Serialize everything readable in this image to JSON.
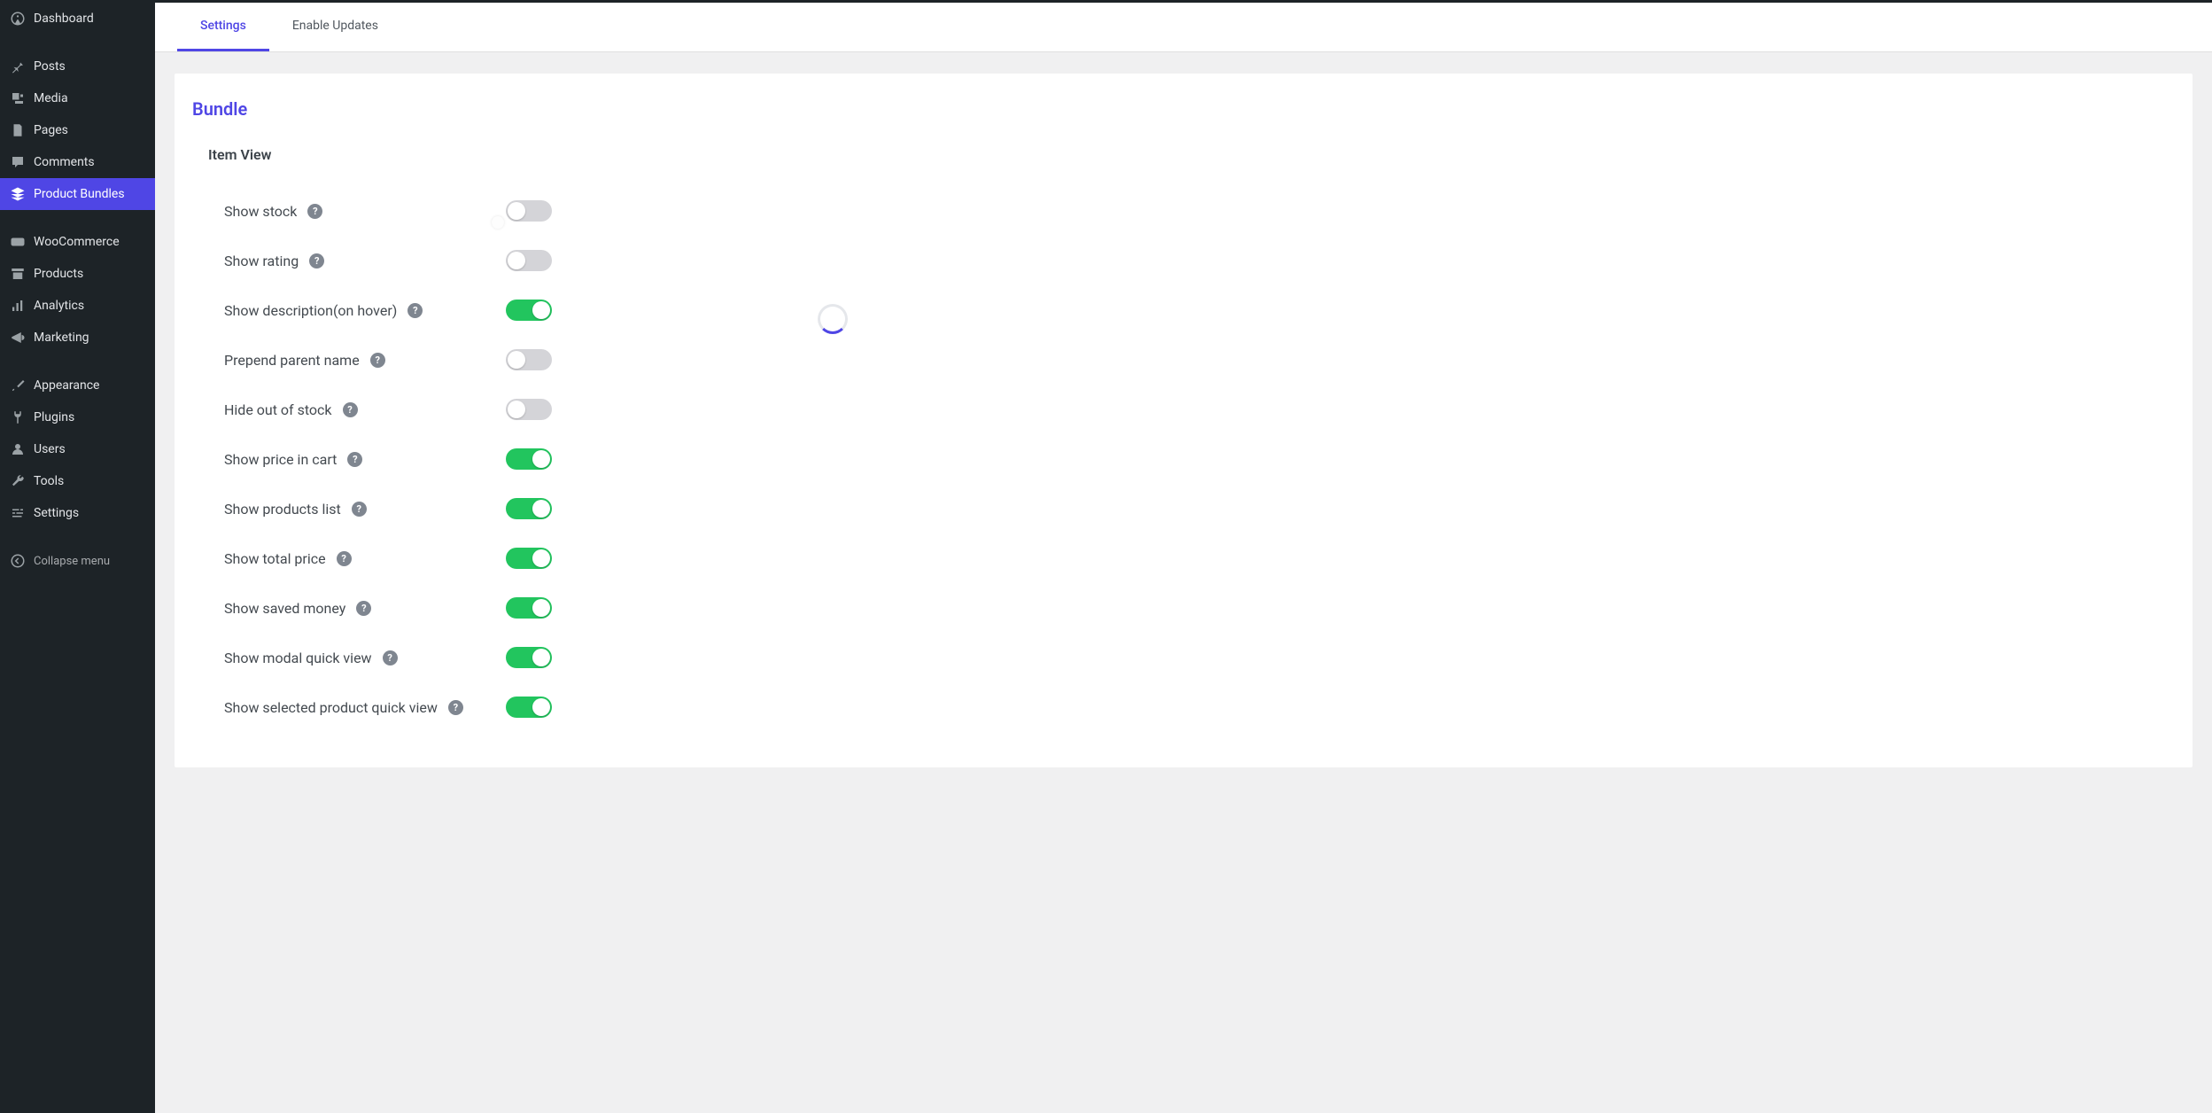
{
  "sidebar": {
    "items": [
      {
        "label": "Dashboard",
        "icon": "dashboard"
      },
      {
        "label": "Posts",
        "icon": "pin"
      },
      {
        "label": "Media",
        "icon": "media"
      },
      {
        "label": "Pages",
        "icon": "page"
      },
      {
        "label": "Comments",
        "icon": "comment"
      },
      {
        "label": "Product Bundles",
        "icon": "layers",
        "active": true
      },
      {
        "label": "WooCommerce",
        "icon": "woo"
      },
      {
        "label": "Products",
        "icon": "archive"
      },
      {
        "label": "Analytics",
        "icon": "analytics"
      },
      {
        "label": "Marketing",
        "icon": "marketing"
      },
      {
        "label": "Appearance",
        "icon": "brush"
      },
      {
        "label": "Plugins",
        "icon": "plug"
      },
      {
        "label": "Users",
        "icon": "user"
      },
      {
        "label": "Tools",
        "icon": "wrench"
      },
      {
        "label": "Settings",
        "icon": "sliders"
      }
    ],
    "collapse_label": "Collapse menu"
  },
  "tabs": [
    {
      "label": "Settings",
      "active": true
    },
    {
      "label": "Enable Updates",
      "active": false
    }
  ],
  "section": {
    "title": "Bundle",
    "group_title": "Item View",
    "settings": [
      {
        "label": "Show stock",
        "value": false
      },
      {
        "label": "Show rating",
        "value": false
      },
      {
        "label": "Show description(on hover)",
        "value": true
      },
      {
        "label": "Prepend parent name",
        "value": false
      },
      {
        "label": "Hide out of stock",
        "value": false
      },
      {
        "label": "Show price in cart",
        "value": true
      },
      {
        "label": "Show products list",
        "value": true
      },
      {
        "label": "Show total price",
        "value": true
      },
      {
        "label": "Show saved money",
        "value": true
      },
      {
        "label": "Show modal quick view",
        "value": true
      },
      {
        "label": "Show selected product quick view",
        "value": true
      }
    ]
  }
}
